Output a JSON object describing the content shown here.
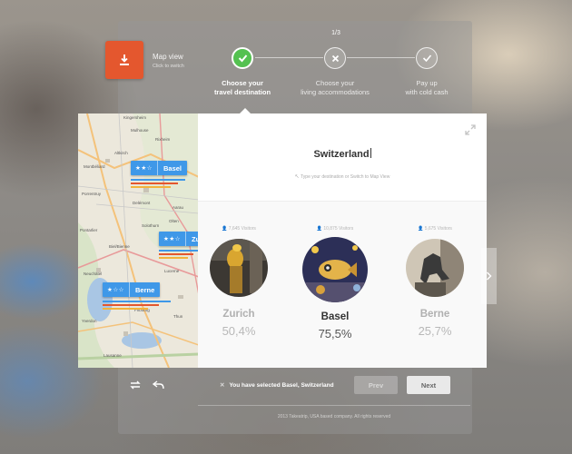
{
  "map_view": {
    "title": "Map view",
    "subtitle": "Click to switch"
  },
  "wizard": {
    "step_counter": "1/3",
    "steps": [
      {
        "line1": "Choose your",
        "line2": "travel destination",
        "state": "done"
      },
      {
        "line1": "Choose your",
        "line2": "living accommodations",
        "state": "todo"
      },
      {
        "line1": "Pay up",
        "line2": "with cold cash",
        "state": "todo"
      }
    ]
  },
  "destination": {
    "value": "Switzerland",
    "hint": "Type your destination or Switch to Map View"
  },
  "map_pins": [
    {
      "stars": "★★☆",
      "name": "Basel"
    },
    {
      "stars": "★★☆",
      "name": "Zurich"
    },
    {
      "stars": "★☆☆",
      "name": "Berne"
    }
  ],
  "map_labels": [
    "Kingersheim",
    "Mulhouse",
    "Rixheim",
    "Altkirch",
    "Porrentruy",
    "Delémont",
    "Biel/Bienne",
    "Neuchâtel",
    "Lausanne",
    "Yverdon",
    "Lucerne",
    "Solothurn",
    "Olten",
    "Aarau",
    "Fribourg",
    "Thun",
    "Pontarlier",
    "Montbéliard"
  ],
  "cities": [
    {
      "visitors": "7,645 Visitors",
      "name": "Zurich",
      "percent": "50,4%",
      "selected": false
    },
    {
      "visitors": "10,875 Visitors",
      "name": "Basel",
      "percent": "75,5%",
      "selected": true
    },
    {
      "visitors": "5,675 Visitors",
      "name": "Berne",
      "percent": "25,7%",
      "selected": false
    }
  ],
  "selection_message": "You have selected Basel, Switzerland",
  "buttons": {
    "prev": "Prev",
    "next": "Next"
  },
  "copyright": "2013 Takeatrip, USA based company. All rights reserved",
  "colors": {
    "accent_orange": "#e4572e",
    "accent_green": "#54c150",
    "pin_blue": "#3f98e8"
  }
}
